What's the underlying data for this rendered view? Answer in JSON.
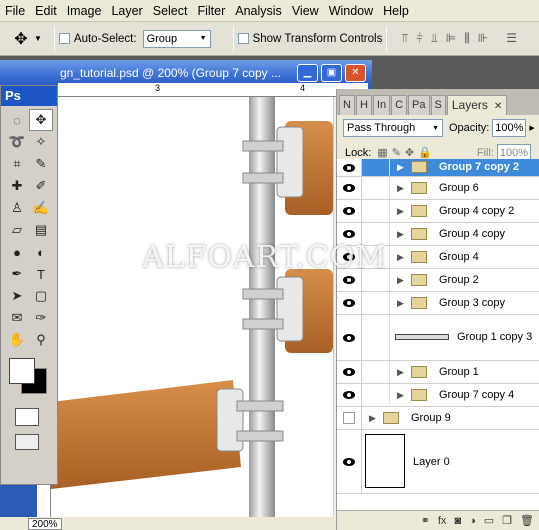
{
  "menu": [
    "File",
    "Edit",
    "Image",
    "Layer",
    "Select",
    "Filter",
    "Analysis",
    "View",
    "Window",
    "Help"
  ],
  "options": {
    "auto_select_label": "Auto-Select:",
    "auto_select_value": "Group",
    "show_transform_label": "Show Transform Controls"
  },
  "document": {
    "title": "gn_tutorial.psd @ 200% (Group 7 copy ...",
    "zoom": "200%",
    "ruler_h": [
      "3",
      "4"
    ]
  },
  "toolbox": {
    "brand": "Ps"
  },
  "layers_panel": {
    "tabs": [
      "N",
      "H",
      "In",
      "C",
      "Pa",
      "S",
      "Layers"
    ],
    "blend_mode": "Pass Through",
    "opacity_label": "Opacity:",
    "opacity": "100%",
    "lock_label": "Lock:",
    "fill_label": "Fill:",
    "fill": "100%",
    "layers": [
      {
        "name": "Group 7 copy 2",
        "selected": true,
        "visible": true,
        "nested": true
      },
      {
        "name": "Group 6",
        "visible": true,
        "nested": true
      },
      {
        "name": "Group 4 copy 2",
        "visible": true,
        "nested": true
      },
      {
        "name": "Group 4 copy",
        "visible": true,
        "nested": true
      },
      {
        "name": "Group 4",
        "visible": true,
        "nested": true
      },
      {
        "name": "Group 2",
        "visible": true,
        "nested": true
      },
      {
        "name": "Group 3 copy",
        "visible": true,
        "nested": true
      },
      {
        "name": "Group 1 copy 3",
        "visible": true,
        "nested": true
      },
      {
        "name": "Group 1",
        "visible": true,
        "nested": true
      },
      {
        "name": "Group 7 copy 4",
        "visible": true,
        "nested": true
      },
      {
        "name": "Group 9",
        "visible": false,
        "nested": false
      },
      {
        "name": "Layer 0",
        "visible": true,
        "nested": false
      }
    ]
  },
  "watermark": "ALFOART.COM",
  "colors": {
    "selection": "#3c8ad9",
    "titlebar": "#2b5cc4",
    "wood": "#c47a3a"
  }
}
